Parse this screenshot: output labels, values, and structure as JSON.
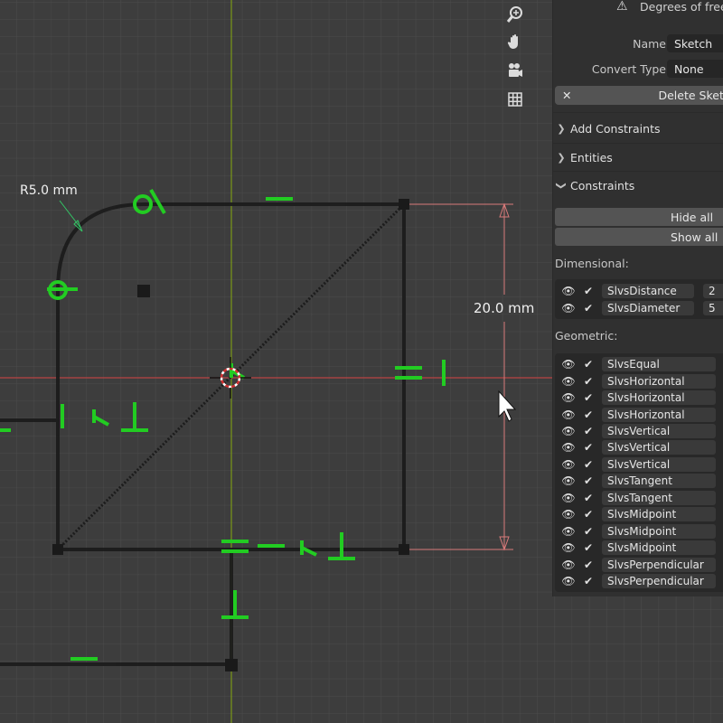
{
  "viewport": {
    "radius_label": "R5.0 mm",
    "distance_label": "20.0 mm",
    "nav_icons": [
      "zoom-icon",
      "hand-pan-icon",
      "camera-icon",
      "grid-icon"
    ],
    "colors": {
      "background": "#3d3d3d",
      "grid": "#4a4a4a",
      "x_axis": "#c24a4a",
      "y_axis": "#7e9a1c",
      "constraint": "#22cc22",
      "sketch_line": "#1c1c1c",
      "dimension": "#e07070"
    }
  },
  "panel": {
    "degrees_text": "Degrees of freedom",
    "name_label": "Name",
    "name_value": "Sketch",
    "convert_label": "Convert Type",
    "convert_value": "None",
    "delete_label": "Delete Sketch",
    "sections": {
      "add_constraints": "Add Constraints",
      "entities": "Entities",
      "constraints": "Constraints"
    },
    "hide_all": "Hide all",
    "show_all": "Show all",
    "dimensional_heading": "Dimensional:",
    "dimensional": [
      {
        "name": "SlvsDistance",
        "value": "2"
      },
      {
        "name": "SlvsDiameter",
        "value": "5"
      }
    ],
    "geometric_heading": "Geometric:",
    "geometric": [
      "SlvsEqual",
      "SlvsHorizontal",
      "SlvsHorizontal",
      "SlvsHorizontal",
      "SlvsVertical",
      "SlvsVertical",
      "SlvsVertical",
      "SlvsTangent",
      "SlvsTangent",
      "SlvsMidpoint",
      "SlvsMidpoint",
      "SlvsMidpoint",
      "SlvsPerpendicular",
      "SlvsPerpendicular"
    ]
  }
}
